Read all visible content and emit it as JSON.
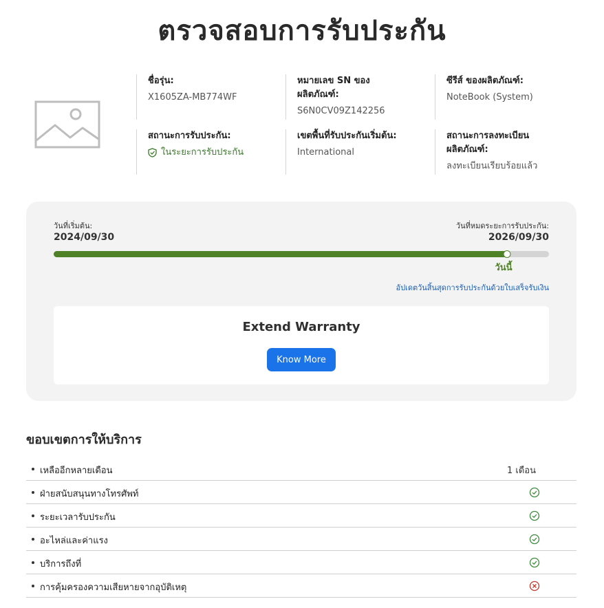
{
  "page": {
    "title": "ตรวจสอบการรับประกัน"
  },
  "product": {
    "image_icon": "image-placeholder-icon",
    "model_label": "ชื่อรุ่น:",
    "model_value": "X1605ZA-MB774WF",
    "sn_label": "หมายเลข SN ของผลิตภัณฑ์:",
    "sn_value": "S6N0CV09Z142256",
    "series_label": "ซีรีส์ ของผลิตภัณฑ์:",
    "series_value": "NoteBook (System)",
    "warranty_status_label": "สถานะการรับประกัน:",
    "warranty_status_value": "ในระยะการรับประกัน",
    "warranty_status_icon": "shield-check-icon",
    "region_label": "เขตพื้นที่รับประกันเริ่มต้น:",
    "region_value": "International",
    "registration_label": "สถานะการลงทะเบียนผลิตภัณฑ์:",
    "registration_value": "ลงทะเบียนเรียบร้อยแล้ว"
  },
  "warranty_period": {
    "start_label": "วันที่เริ่มต้น:",
    "start_date": "2024/09/30",
    "end_label": "วันที่หมดระยะการรับประกัน:",
    "end_date": "2026/09/30",
    "progress_fraction": 0.915,
    "today_label": "วันนี้",
    "update_link": "อัปเดตวันสิ้นสุดการรับประกันด้วยใบเสร็จรับเงิน",
    "colors": {
      "fill": "#4f8227",
      "track": "#d4d4d4"
    }
  },
  "extend": {
    "title": "Extend Warranty",
    "button_label": "Know More",
    "button_color": "#1a73e8"
  },
  "services": {
    "title": "ขอบเขตการให้บริการ",
    "rows": [
      {
        "name": "เหลืออีกหลายเดือน",
        "status_type": "text",
        "status_text": "1 เดือน"
      },
      {
        "name": "ฝ่ายสนับสนุนทางโทรศัพท์",
        "status_type": "check",
        "icon": "check-circle-icon"
      },
      {
        "name": "ระยะเวลารับประกัน",
        "status_type": "check",
        "icon": "check-circle-icon"
      },
      {
        "name": "อะไหล่และค่าแรง",
        "status_type": "check",
        "icon": "check-circle-icon"
      },
      {
        "name": "บริการถึงที่",
        "status_type": "check",
        "icon": "check-circle-icon"
      },
      {
        "name": "การคุ้มครองความเสียหายจากอุบัติเหตุ",
        "status_type": "cross",
        "icon": "x-circle-icon"
      }
    ],
    "colors": {
      "check": "#3a8a3a",
      "cross": "#c0392b"
    }
  }
}
